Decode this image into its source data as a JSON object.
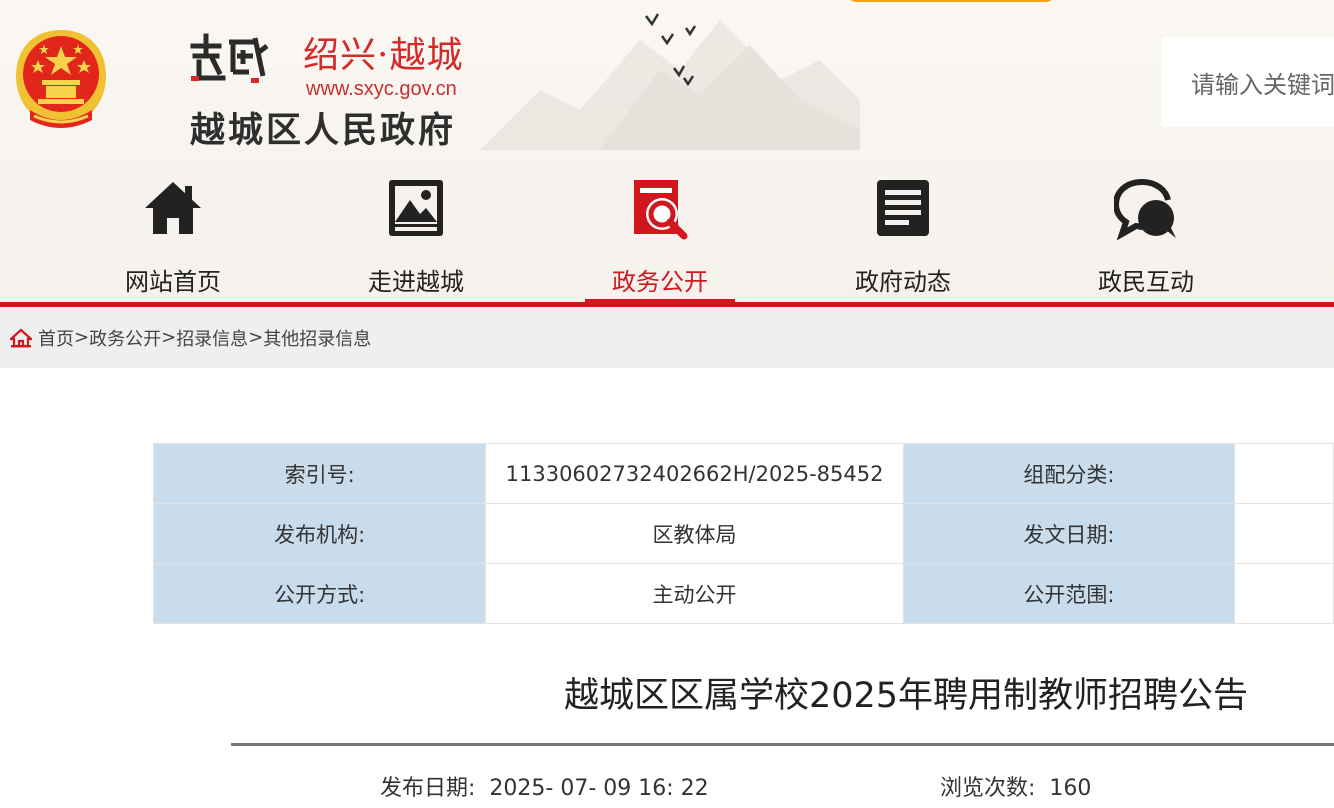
{
  "header": {
    "city_name": "绍兴·越城",
    "site_url": "www.sxyc.gov.cn",
    "gov_name": "越城区人民政府",
    "search_placeholder": "请输入关键词"
  },
  "nav": {
    "items": [
      {
        "label": "网站首页",
        "icon": "home-icon"
      },
      {
        "label": "走进越城",
        "icon": "picture-icon"
      },
      {
        "label": "政务公开",
        "icon": "document-search-icon",
        "active": true
      },
      {
        "label": "政府动态",
        "icon": "news-icon"
      },
      {
        "label": "政民互动",
        "icon": "chat-icon"
      }
    ]
  },
  "breadcrumb": {
    "items": [
      "首页",
      "政务公开",
      "招录信息",
      "其他招录信息"
    ],
    "separator": ">"
  },
  "meta": {
    "index_no_label": "索引号:",
    "index_no_value": "11330602732402662H/2025-85452",
    "category_label": "组配分类:",
    "publisher_label": "发布机构:",
    "publisher_value": "区教体局",
    "doc_date_label": "发文日期:",
    "open_mode_label": "公开方式:",
    "open_mode_value": "主动公开",
    "open_scope_label": "公开范围:"
  },
  "article": {
    "title": "越城区区属学校2025年聘用制教师招聘公告",
    "publish_label": "发布日期:",
    "publish_value": "2025- 07- 09 16: 22",
    "views_label": "浏览次数:",
    "views_value": "160"
  },
  "colors": {
    "brand_red": "#d2161e",
    "label_cell_blue": "#c9dcec",
    "breadcrumb_bg": "#efefef",
    "search_tab_orange": "#f3a21b"
  }
}
